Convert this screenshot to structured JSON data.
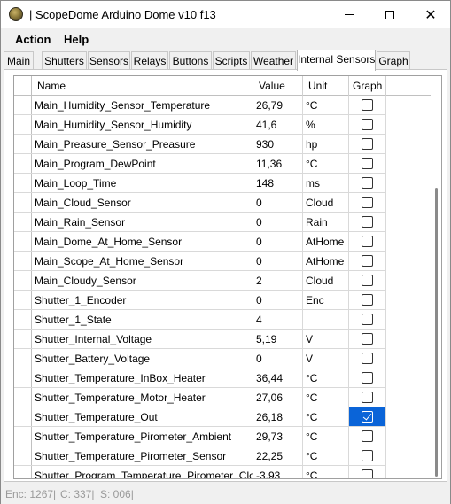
{
  "window": {
    "title": "| ScopeDome Arduino Dome v10 f13",
    "icon": "dome-app-icon",
    "minimize_icon": "minimize-icon",
    "maximize_icon": "maximize-icon",
    "close_glyph": "✕"
  },
  "menu": {
    "action": "Action",
    "help": "Help"
  },
  "tabs": [
    {
      "label": "Main"
    },
    {
      "label": "Shutters"
    },
    {
      "label": "Sensors"
    },
    {
      "label": "Relays"
    },
    {
      "label": "Buttons"
    },
    {
      "label": "Scripts"
    },
    {
      "label": "Weather"
    },
    {
      "label": "Internal Sensors"
    },
    {
      "label": "Graph"
    }
  ],
  "active_tab": "Internal Sensors",
  "grid": {
    "columns": {
      "name": "Name",
      "value": "Value",
      "unit": "Unit",
      "graph": "Graph"
    },
    "rows": [
      {
        "name": "Main_Humidity_Sensor_Temperature",
        "value": "26,79",
        "unit": "°C",
        "graph": false
      },
      {
        "name": "Main_Humidity_Sensor_Humidity",
        "value": "41,6",
        "unit": "%",
        "graph": false
      },
      {
        "name": "Main_Preasure_Sensor_Preasure",
        "value": "930",
        "unit": "hp",
        "graph": false
      },
      {
        "name": "Main_Program_DewPoint",
        "value": "11,36",
        "unit": "°C",
        "graph": false
      },
      {
        "name": "Main_Loop_Time",
        "value": "148",
        "unit": "ms",
        "graph": false
      },
      {
        "name": "Main_Cloud_Sensor",
        "value": "0",
        "unit": "Cloud",
        "graph": false
      },
      {
        "name": "Main_Rain_Sensor",
        "value": "0",
        "unit": "Rain",
        "graph": false
      },
      {
        "name": "Main_Dome_At_Home_Sensor",
        "value": "0",
        "unit": "AtHome",
        "graph": false
      },
      {
        "name": "Main_Scope_At_Home_Sensor",
        "value": "0",
        "unit": "AtHome",
        "graph": false
      },
      {
        "name": "Main_Cloudy_Sensor",
        "value": "2",
        "unit": "Cloud",
        "graph": false
      },
      {
        "name": "Shutter_1_Encoder",
        "value": "0",
        "unit": "Enc",
        "graph": false
      },
      {
        "name": "Shutter_1_State",
        "value": "4",
        "unit": "",
        "graph": false
      },
      {
        "name": "Shutter_Internal_Voltage",
        "value": "5,19",
        "unit": "V",
        "graph": false
      },
      {
        "name": "Shutter_Battery_Voltage",
        "value": "0",
        "unit": "V",
        "graph": false
      },
      {
        "name": "Shutter_Temperature_InBox_Heater",
        "value": "36,44",
        "unit": "°C",
        "graph": false
      },
      {
        "name": "Shutter_Temperature_Motor_Heater",
        "value": "27,06",
        "unit": "°C",
        "graph": false
      },
      {
        "name": "Shutter_Temperature_Out",
        "value": "26,18",
        "unit": "°C",
        "graph": true
      },
      {
        "name": "Shutter_Temperature_Pirometer_Ambient",
        "value": "29,73",
        "unit": "°C",
        "graph": false
      },
      {
        "name": "Shutter_Temperature_Pirometer_Sensor",
        "value": "22,25",
        "unit": "°C",
        "graph": false
      },
      {
        "name": "Shutter_Program_Temperature_Pirometer_Cloud...",
        "value": "-3,93",
        "unit": "°C",
        "graph": false
      }
    ]
  },
  "colors": {
    "selection": "#0a64d8",
    "status_text": "#9a9a9a"
  },
  "status": {
    "enc": "Enc: 1267|",
    "c": "C: 337|",
    "s": "S: 006|"
  }
}
